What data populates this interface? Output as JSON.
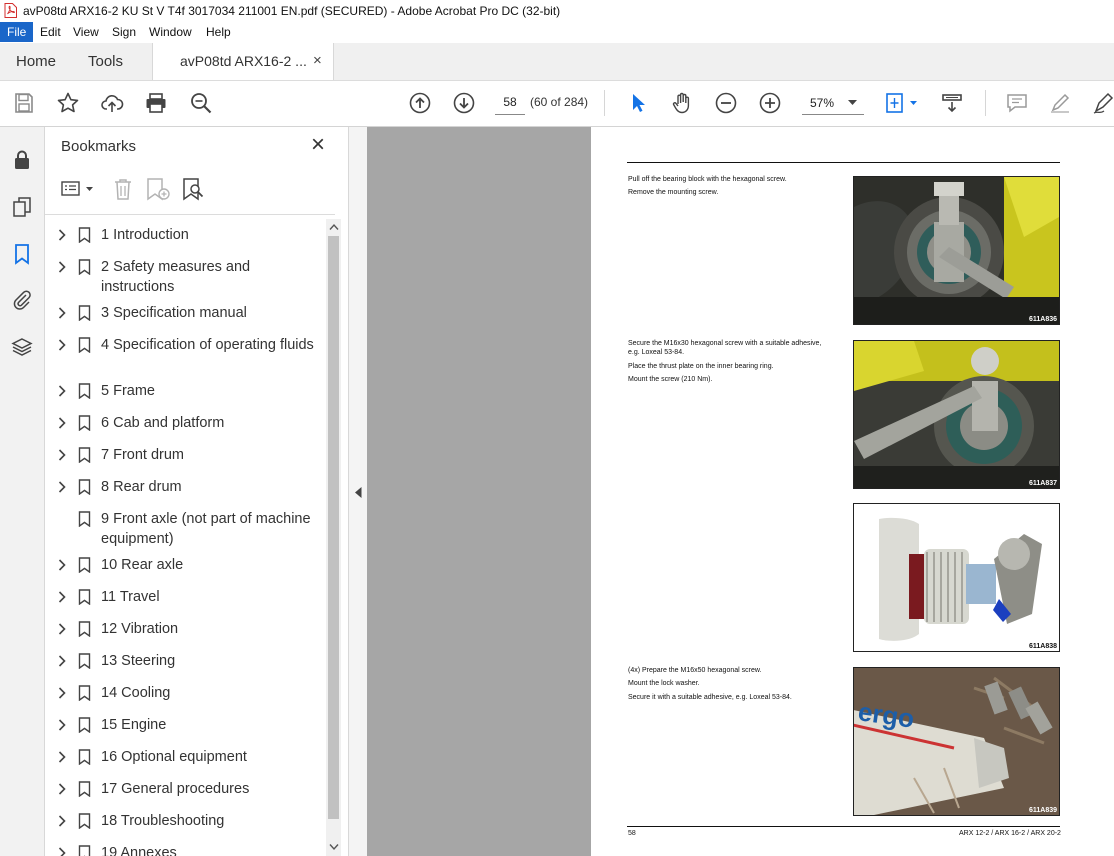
{
  "window": {
    "title": "avP08td ARX16-2 KU St V T4f 3017034 211001 EN.pdf (SECURED) - Adobe Acrobat Pro DC (32-bit)"
  },
  "menu": {
    "items": [
      "File",
      "Edit",
      "View",
      "Sign",
      "Window",
      "Help"
    ]
  },
  "tabs": {
    "home": "Home",
    "tools": "Tools",
    "document": "avP08td ARX16-2 ...",
    "close": "×"
  },
  "toolbar": {
    "page_number": "58",
    "page_count": "(60 of 284)",
    "zoom": "57%"
  },
  "bookmarks": {
    "title": "Bookmarks",
    "close": "×",
    "items": [
      {
        "label": "1 Introduction",
        "expandable": true
      },
      {
        "label": "2 Safety measures and instructions",
        "expandable": true
      },
      {
        "label": "3 Specification manual",
        "expandable": true
      },
      {
        "label": "4 Specification of operating fluids",
        "expandable": true
      },
      {
        "label": "5 Frame",
        "expandable": true
      },
      {
        "label": "6 Cab and platform",
        "expandable": true
      },
      {
        "label": "7 Front drum",
        "expandable": true
      },
      {
        "label": "8 Rear drum",
        "expandable": true
      },
      {
        "label": "9 Front axle (not part of machine equipment)",
        "expandable": false
      },
      {
        "label": "10 Rear axle",
        "expandable": true
      },
      {
        "label": "11 Travel",
        "expandable": true
      },
      {
        "label": "12 Vibration",
        "expandable": true
      },
      {
        "label": "13 Steering",
        "expandable": true
      },
      {
        "label": "14 Cooling",
        "expandable": true
      },
      {
        "label": "15 Engine",
        "expandable": true
      },
      {
        "label": "16 Optional equipment",
        "expandable": true
      },
      {
        "label": "17 General procedures",
        "expandable": true
      },
      {
        "label": "18 Troubleshooting",
        "expandable": true
      },
      {
        "label": "19 Annexes",
        "expandable": true
      }
    ]
  },
  "page": {
    "step1": [
      "Pull off the bearing block with the hexagonal screw.",
      "Remove the mounting screw."
    ],
    "step2": [
      "Secure the M16x30 hexagonal screw with a suitable adhesive,",
      "e.g. Loxeal 53-84.",
      "Place the thrust plate on the inner bearing ring.",
      "Mount the screw (210 Nm)."
    ],
    "step4": [
      "(4x) Prepare the M16x50 hexagonal screw.",
      "Mount the lock washer.",
      "Secure it with a suitable adhesive, e.g. Loxeal 53-84."
    ],
    "photo_codes": [
      "611A836",
      "611A837",
      "611A838",
      "611A839"
    ],
    "brand_text": "ergo",
    "footer_page": "58",
    "footer_models": "ARX 12-2 / ARX 16-2 / ARX 20-2"
  }
}
